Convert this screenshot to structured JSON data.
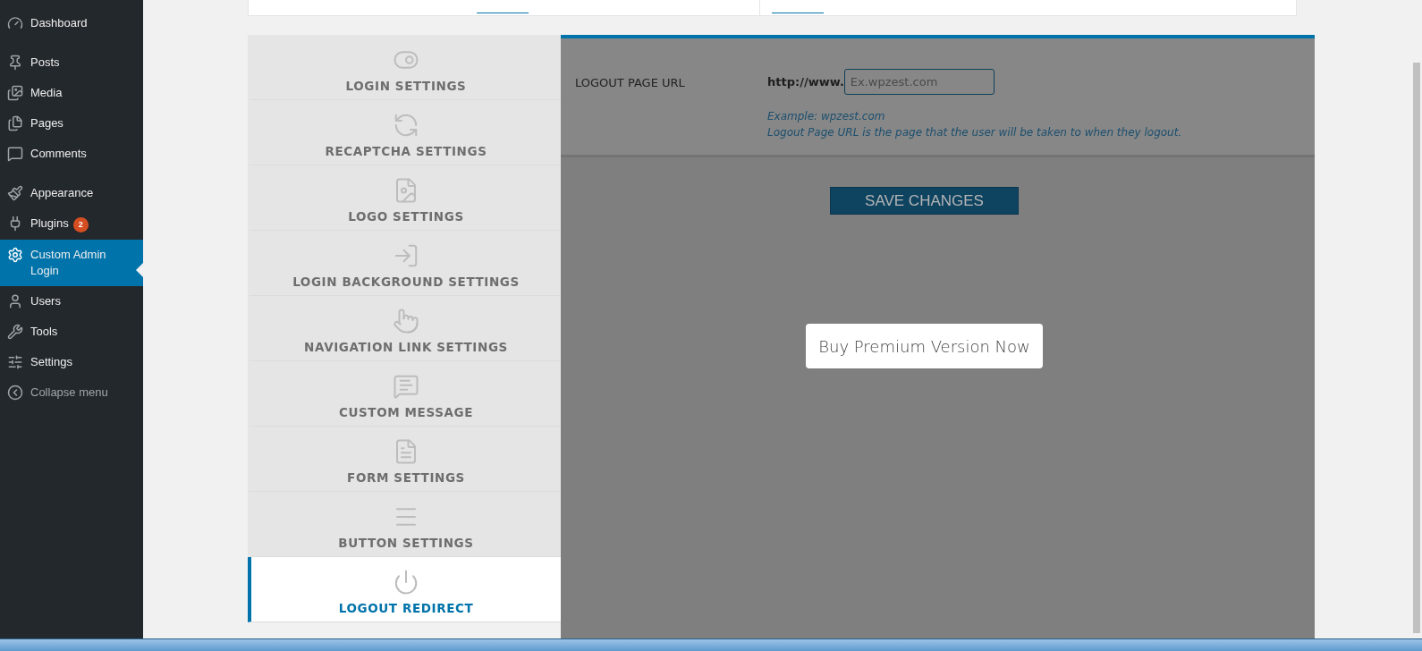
{
  "sidebar": {
    "items": [
      {
        "label": "Dashboard",
        "selected": false
      },
      {
        "label": "Posts",
        "selected": false
      },
      {
        "label": "Media",
        "selected": false
      },
      {
        "label": "Pages",
        "selected": false
      },
      {
        "label": "Comments",
        "selected": false
      },
      {
        "label": "Appearance",
        "selected": false
      },
      {
        "label": "Plugins",
        "selected": false,
        "badge": "2"
      },
      {
        "label": "Custom Admin Login",
        "selected": true
      },
      {
        "label": "Users",
        "selected": false
      },
      {
        "label": "Tools",
        "selected": false
      },
      {
        "label": "Settings",
        "selected": false
      },
      {
        "label": "Collapse menu",
        "selected": false
      }
    ]
  },
  "tabs": [
    {
      "label": "LOGIN SETTINGS",
      "selected": false
    },
    {
      "label": "RECAPTCHA SETTINGS",
      "selected": false
    },
    {
      "label": "LOGO SETTINGS",
      "selected": false
    },
    {
      "label": "LOGIN BACKGROUND SETTINGS",
      "selected": false
    },
    {
      "label": "NAVIGATION LINK SETTINGS",
      "selected": false
    },
    {
      "label": "CUSTOM MESSAGE",
      "selected": false
    },
    {
      "label": "FORM SETTINGS",
      "selected": false
    },
    {
      "label": "BUTTON SETTINGS",
      "selected": false
    },
    {
      "label": "LOGOUT REDIRECT",
      "selected": true
    }
  ],
  "panel": {
    "field_label": "LOGOUT PAGE URL",
    "prefix": "http://www.",
    "placeholder": "Ex.wpzest.com",
    "help": [
      "Example: wpzest.com",
      "Logout Page URL is the page that the user will be taken to when they logout."
    ],
    "save_button": "SAVE CHANGES",
    "premium_button": "Buy Premium Version Now"
  }
}
